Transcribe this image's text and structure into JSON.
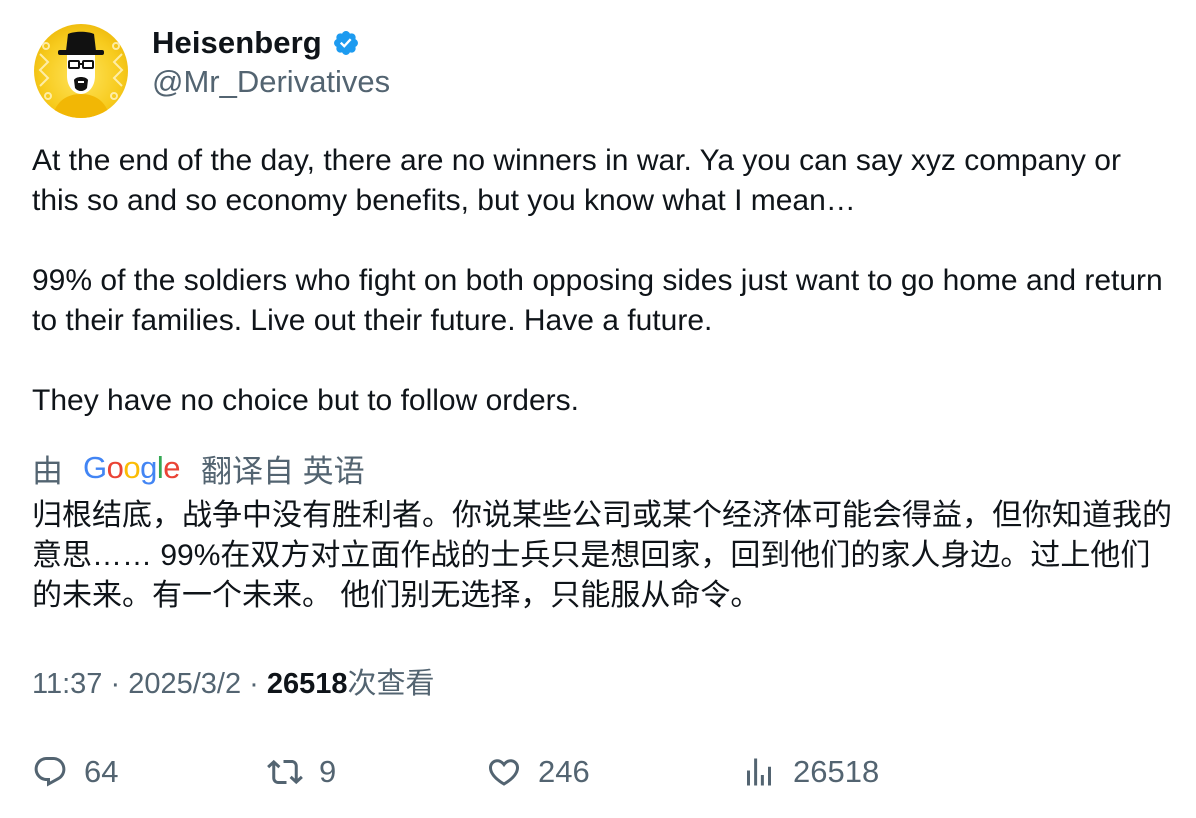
{
  "author": {
    "display_name": "Heisenberg",
    "handle": "@Mr_Derivatives",
    "verified": true,
    "avatar_icon": "heisenberg-avatar-icon",
    "avatar_color": "#F5C518"
  },
  "tweet": {
    "paragraphs": [
      "At the end of the day, there are no winners in war. Ya you can say xyz company or this so and so economy benefits, but you know what I mean…",
      "99% of the soldiers who fight on both opposing sides just want to go home and return to their families. Live out their future. Have a future.",
      "They have no choice but to follow orders."
    ]
  },
  "translation": {
    "by_label": "由",
    "provider": "Google",
    "from_label": "翻译自 英语",
    "text": "归根结底，战争中没有胜利者。你说某些公司或某个经济体可能会得益，但你知道我的意思…… 99%在双方对立面作战的士兵只是想回家，回到他们的家人身边。过上他们的未来。有一个未来。 他们别无选择，只能服从命令。"
  },
  "meta": {
    "time": "11:37",
    "separator": " · ",
    "date": "2025/3/2",
    "views_count": "26518",
    "views_label": "次查看"
  },
  "actions": {
    "reply_count": "64",
    "retweet_count": "9",
    "like_count": "246",
    "views_count": "26518"
  },
  "colors": {
    "text_primary": "#0f1419",
    "text_secondary": "#536471",
    "verified_blue": "#1d9bf0"
  }
}
